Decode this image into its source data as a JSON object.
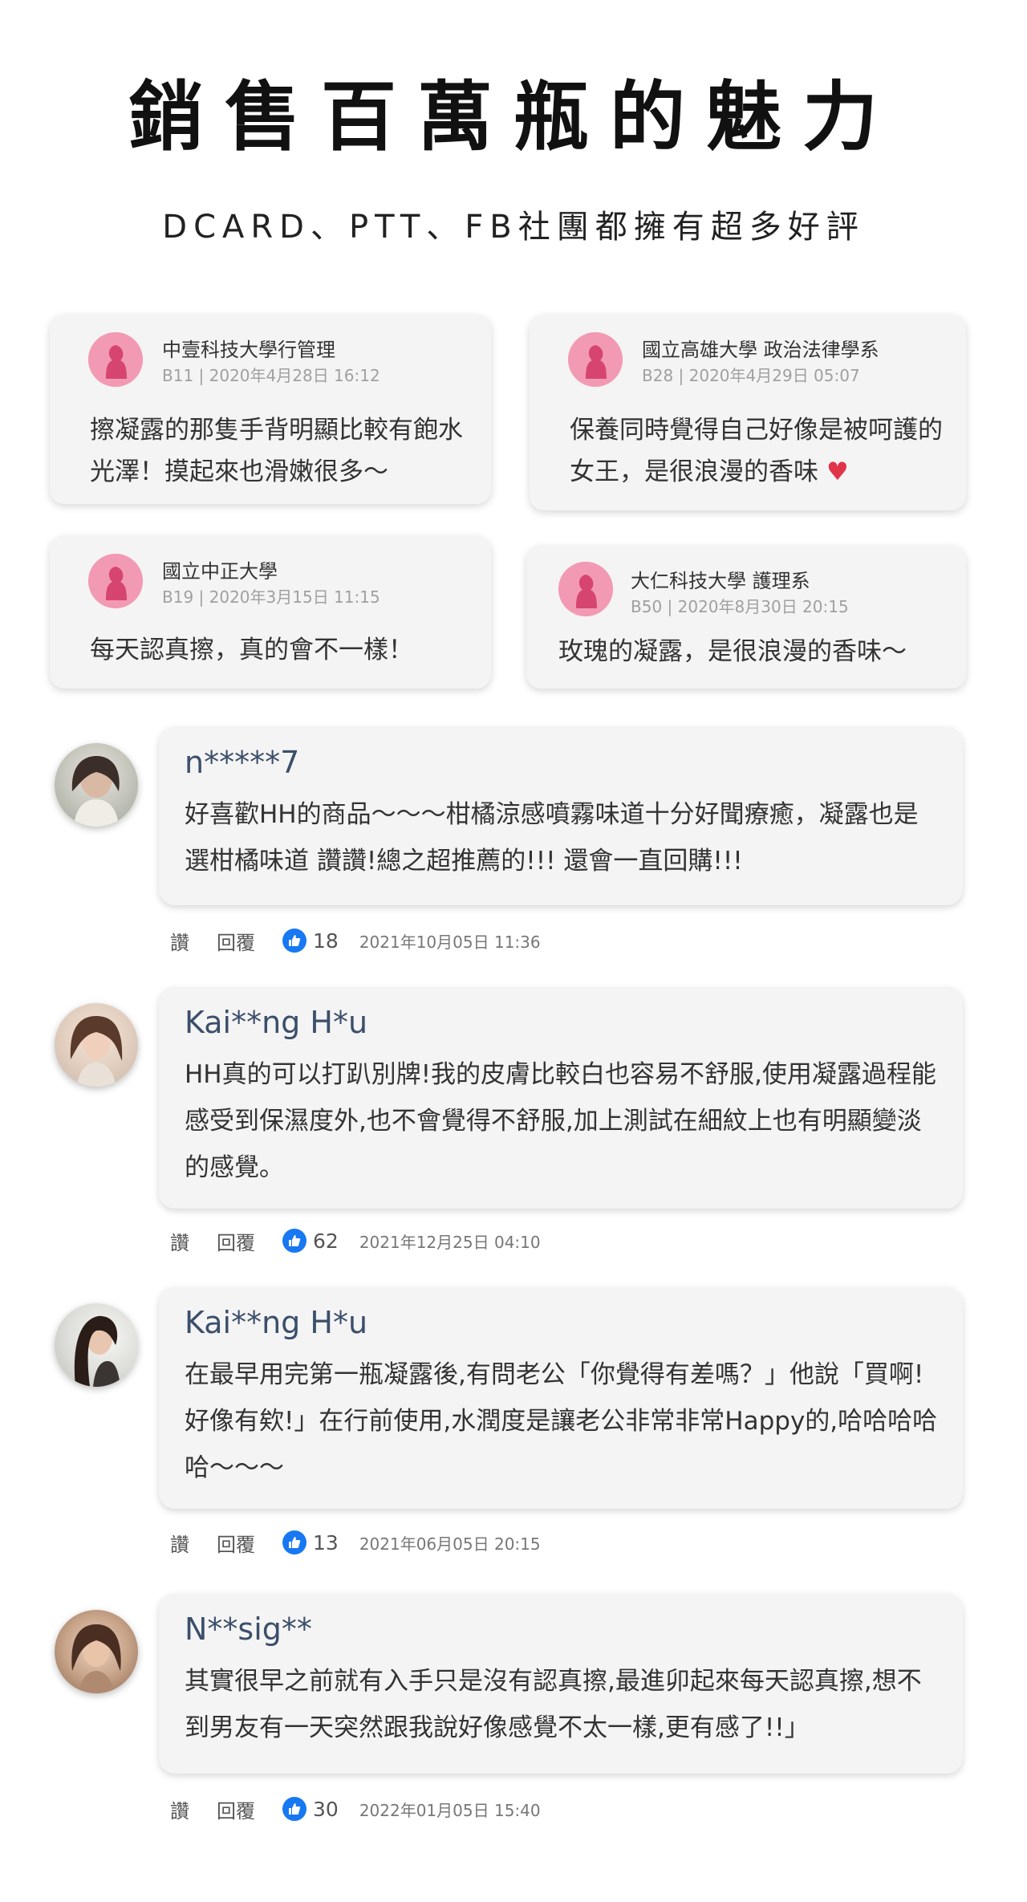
{
  "header": {
    "title": "銷售百萬瓶的魅力",
    "subtitle": "DCARD、PTT、FB社團都擁有超多好評"
  },
  "forum_cards": [
    {
      "school": "中壹科技大學行管理",
      "meta": "B11 | 2020年4月28日 16:12",
      "text": "擦凝露的那隻手背明顯比較有飽水光澤！摸起來也滑嫩很多～",
      "heart": ""
    },
    {
      "school": "國立高雄大學 政治法律學系",
      "meta": "B28 | 2020年4月29日 05:07",
      "text": "保養同時覺得自己好像是被呵護的女王，是很浪漫的香味",
      "heart": "♥"
    },
    {
      "school": "國立中正大學",
      "meta": "B19 | 2020年3月15日 11:15",
      "text": "每天認真擦，真的會不一樣！",
      "heart": ""
    },
    {
      "school": "大仁科技大學 護理系",
      "meta": "B50 | 2020年8月30日 20:15",
      "text": "玫瑰的凝露，是很浪漫的香味～",
      "heart": ""
    }
  ],
  "comments": [
    {
      "username": "n*****7",
      "text": "好喜歡HH的商品～～～柑橘涼感噴霧味道十分好聞療癒，凝露也是選柑橘味道 讚讚!總之超推薦的!!! 還會一直回購!!!",
      "like_label": "讚",
      "reply_label": "回覆",
      "likes": "18",
      "time": "2021年10月05日 11:36"
    },
    {
      "username": "Kai**ng H*u",
      "text": "HH真的可以打趴別牌!我的皮膚比較白也容易不舒服,使用凝露過程能感受到保濕度外,也不會覺得不舒服,加上測試在細紋上也有明顯變淡的感覺。",
      "like_label": "讚",
      "reply_label": "回覆",
      "likes": "62",
      "time": "2021年12月25日 04:10"
    },
    {
      "username": "Kai**ng H*u",
      "text": "在最早用完第一瓶凝露後,有問老公「你覺得有差嗎？」他說「買啊!好像有欸!」在行前使用,水潤度是讓老公非常非常Happy的,哈哈哈哈哈～～～",
      "like_label": "讚",
      "reply_label": "回覆",
      "likes": "13",
      "time": "2021年06月05日 20:15"
    },
    {
      "username": "N**sig**",
      "text": "其實很早之前就有入手只是沒有認真擦,最進卯起來每天認真擦,想不到男友有一天突然跟我說好像感覺不太一樣,更有感了!!」",
      "like_label": "讚",
      "reply_label": "回覆",
      "likes": "30",
      "time": "2022年01月05日 15:40"
    }
  ],
  "colors": {
    "avatar_pink": "#f29ab3",
    "username_blue": "#3b4f6b",
    "like_blue": "#1778f2",
    "heart_red": "#e0344a"
  }
}
